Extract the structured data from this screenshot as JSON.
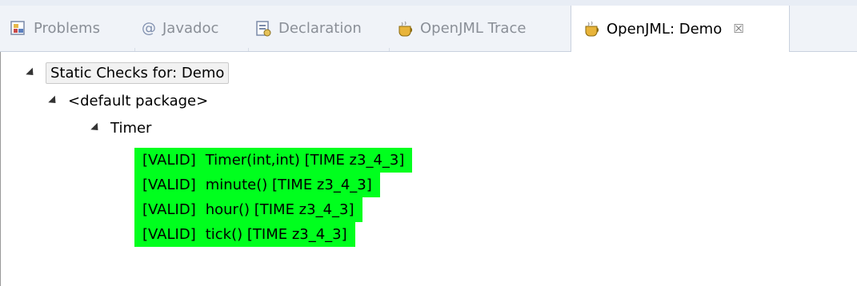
{
  "tabs": [
    {
      "label": "Problems",
      "icon": "problems-icon",
      "active": false
    },
    {
      "label": "Javadoc",
      "icon": "at-icon",
      "active": false
    },
    {
      "label": "Declaration",
      "icon": "declaration-icon",
      "active": false
    },
    {
      "label": "OpenJML Trace",
      "icon": "openjml-icon",
      "active": false
    },
    {
      "label": "OpenJML: Demo",
      "icon": "openjml-icon",
      "active": true,
      "close_glyph": "☒"
    }
  ],
  "tree": {
    "root_label": "Static Checks for: Demo",
    "package_label": "<default package>",
    "class_label": "Timer",
    "results": [
      {
        "status": "[VALID]",
        "text": "Timer(int,int) [TIME z3_4_3]"
      },
      {
        "status": "[VALID]",
        "text": "minute() [TIME z3_4_3]"
      },
      {
        "status": "[VALID]",
        "text": "hour() [TIME z3_4_3]"
      },
      {
        "status": "[VALID]",
        "text": "tick() [TIME z3_4_3]"
      }
    ]
  },
  "colors": {
    "valid_highlight": "#00ff1e",
    "tabbar_bg": "#f0f3f8",
    "inactive_tab_text": "#8a8f97"
  }
}
